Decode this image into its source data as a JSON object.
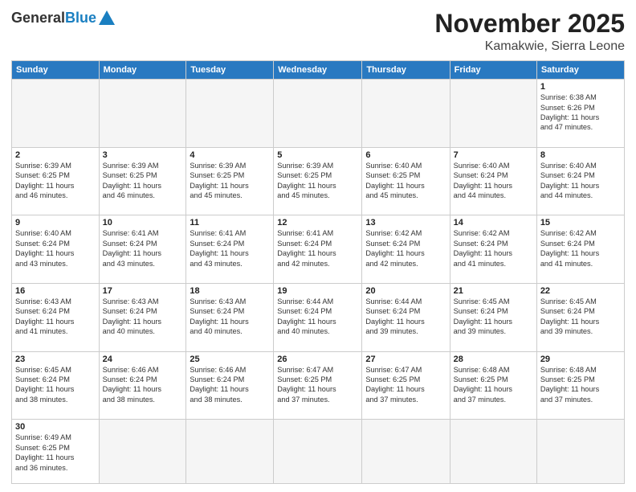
{
  "header": {
    "logo_general": "General",
    "logo_blue": "Blue",
    "month": "November 2025",
    "location": "Kamakwie, Sierra Leone"
  },
  "weekdays": [
    "Sunday",
    "Monday",
    "Tuesday",
    "Wednesday",
    "Thursday",
    "Friday",
    "Saturday"
  ],
  "weeks": [
    [
      {
        "day": "",
        "info": ""
      },
      {
        "day": "",
        "info": ""
      },
      {
        "day": "",
        "info": ""
      },
      {
        "day": "",
        "info": ""
      },
      {
        "day": "",
        "info": ""
      },
      {
        "day": "",
        "info": ""
      },
      {
        "day": "1",
        "info": "Sunrise: 6:38 AM\nSunset: 6:26 PM\nDaylight: 11 hours\nand 47 minutes."
      }
    ],
    [
      {
        "day": "2",
        "info": "Sunrise: 6:39 AM\nSunset: 6:25 PM\nDaylight: 11 hours\nand 46 minutes."
      },
      {
        "day": "3",
        "info": "Sunrise: 6:39 AM\nSunset: 6:25 PM\nDaylight: 11 hours\nand 46 minutes."
      },
      {
        "day": "4",
        "info": "Sunrise: 6:39 AM\nSunset: 6:25 PM\nDaylight: 11 hours\nand 45 minutes."
      },
      {
        "day": "5",
        "info": "Sunrise: 6:39 AM\nSunset: 6:25 PM\nDaylight: 11 hours\nand 45 minutes."
      },
      {
        "day": "6",
        "info": "Sunrise: 6:40 AM\nSunset: 6:25 PM\nDaylight: 11 hours\nand 45 minutes."
      },
      {
        "day": "7",
        "info": "Sunrise: 6:40 AM\nSunset: 6:24 PM\nDaylight: 11 hours\nand 44 minutes."
      },
      {
        "day": "8",
        "info": "Sunrise: 6:40 AM\nSunset: 6:24 PM\nDaylight: 11 hours\nand 44 minutes."
      }
    ],
    [
      {
        "day": "9",
        "info": "Sunrise: 6:40 AM\nSunset: 6:24 PM\nDaylight: 11 hours\nand 43 minutes."
      },
      {
        "day": "10",
        "info": "Sunrise: 6:41 AM\nSunset: 6:24 PM\nDaylight: 11 hours\nand 43 minutes."
      },
      {
        "day": "11",
        "info": "Sunrise: 6:41 AM\nSunset: 6:24 PM\nDaylight: 11 hours\nand 43 minutes."
      },
      {
        "day": "12",
        "info": "Sunrise: 6:41 AM\nSunset: 6:24 PM\nDaylight: 11 hours\nand 42 minutes."
      },
      {
        "day": "13",
        "info": "Sunrise: 6:42 AM\nSunset: 6:24 PM\nDaylight: 11 hours\nand 42 minutes."
      },
      {
        "day": "14",
        "info": "Sunrise: 6:42 AM\nSunset: 6:24 PM\nDaylight: 11 hours\nand 41 minutes."
      },
      {
        "day": "15",
        "info": "Sunrise: 6:42 AM\nSunset: 6:24 PM\nDaylight: 11 hours\nand 41 minutes."
      }
    ],
    [
      {
        "day": "16",
        "info": "Sunrise: 6:43 AM\nSunset: 6:24 PM\nDaylight: 11 hours\nand 41 minutes."
      },
      {
        "day": "17",
        "info": "Sunrise: 6:43 AM\nSunset: 6:24 PM\nDaylight: 11 hours\nand 40 minutes."
      },
      {
        "day": "18",
        "info": "Sunrise: 6:43 AM\nSunset: 6:24 PM\nDaylight: 11 hours\nand 40 minutes."
      },
      {
        "day": "19",
        "info": "Sunrise: 6:44 AM\nSunset: 6:24 PM\nDaylight: 11 hours\nand 40 minutes."
      },
      {
        "day": "20",
        "info": "Sunrise: 6:44 AM\nSunset: 6:24 PM\nDaylight: 11 hours\nand 39 minutes."
      },
      {
        "day": "21",
        "info": "Sunrise: 6:45 AM\nSunset: 6:24 PM\nDaylight: 11 hours\nand 39 minutes."
      },
      {
        "day": "22",
        "info": "Sunrise: 6:45 AM\nSunset: 6:24 PM\nDaylight: 11 hours\nand 39 minutes."
      }
    ],
    [
      {
        "day": "23",
        "info": "Sunrise: 6:45 AM\nSunset: 6:24 PM\nDaylight: 11 hours\nand 38 minutes."
      },
      {
        "day": "24",
        "info": "Sunrise: 6:46 AM\nSunset: 6:24 PM\nDaylight: 11 hours\nand 38 minutes."
      },
      {
        "day": "25",
        "info": "Sunrise: 6:46 AM\nSunset: 6:24 PM\nDaylight: 11 hours\nand 38 minutes."
      },
      {
        "day": "26",
        "info": "Sunrise: 6:47 AM\nSunset: 6:25 PM\nDaylight: 11 hours\nand 37 minutes."
      },
      {
        "day": "27",
        "info": "Sunrise: 6:47 AM\nSunset: 6:25 PM\nDaylight: 11 hours\nand 37 minutes."
      },
      {
        "day": "28",
        "info": "Sunrise: 6:48 AM\nSunset: 6:25 PM\nDaylight: 11 hours\nand 37 minutes."
      },
      {
        "day": "29",
        "info": "Sunrise: 6:48 AM\nSunset: 6:25 PM\nDaylight: 11 hours\nand 37 minutes."
      }
    ],
    [
      {
        "day": "30",
        "info": "Sunrise: 6:49 AM\nSunset: 6:25 PM\nDaylight: 11 hours\nand 36 minutes."
      },
      {
        "day": "",
        "info": ""
      },
      {
        "day": "",
        "info": ""
      },
      {
        "day": "",
        "info": ""
      },
      {
        "day": "",
        "info": ""
      },
      {
        "day": "",
        "info": ""
      },
      {
        "day": "",
        "info": ""
      }
    ]
  ]
}
